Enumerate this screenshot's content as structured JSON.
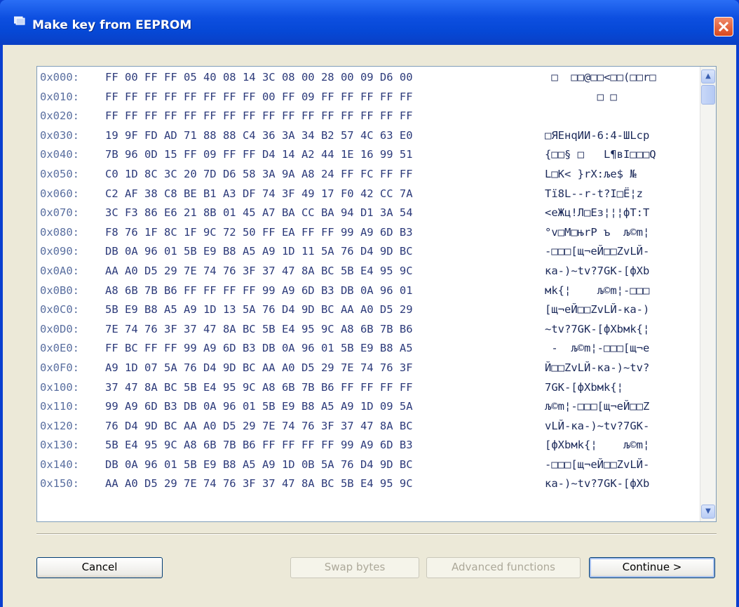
{
  "window": {
    "title": "Make key from EEPROM"
  },
  "hex_dump": {
    "rows": [
      {
        "addr": "0x000:",
        "bytes": "FF 00 FF FF 05 40 08 14 3C 08 00 28 00 09 D6 00",
        "ascii": " □  □□@□□<□□(□□r□"
      },
      {
        "addr": "0x010:",
        "bytes": "FF FF FF FF FF FF FF FF 00 FF 09 FF FF FF FF FF",
        "ascii": "        □ □"
      },
      {
        "addr": "0x020:",
        "bytes": "FF FF FF FF FF FF FF FF FF FF FF FF FF FF FF FF",
        "ascii": ""
      },
      {
        "addr": "0x030:",
        "bytes": "19 9F FD AD 71 88 88 C4 36 3A 34 B2 57 4C 63 E0",
        "ascii": "□ЯEнqИИ-6:4-ШLcp"
      },
      {
        "addr": "0x040:",
        "bytes": "7B 96 0D 15 FF 09 FF FF D4 14 A2 44 1E 16 99 51",
        "ascii": "{□□§ □   L¶вI□□□Q"
      },
      {
        "addr": "0x050:",
        "bytes": "C0 1D 8C 3C 20 7D D6 58 3A 9A A8 24 FF FC FF FF",
        "ascii": "L□К< }rX:ље$ №"
      },
      {
        "addr": "0x060:",
        "bytes": "C2 AF 38 C8 BE B1 A3 DF 74 3F 49 17 F0 42 CC 7A",
        "ascii": "Tї8L--r-t?I□Ё¦z"
      },
      {
        "addr": "0x070:",
        "bytes": "3C F3 86 E6 21 8B 01 45 A7 BA CC BA 94 D1 3A 54",
        "ascii": "<еЖц!Л□Eз¦¦¦фT:T"
      },
      {
        "addr": "0x080:",
        "bytes": "F8 76 1F 8C 1F 9C 72 50 FF EA FF FF 99 A9 6D B3",
        "ascii": "°v□М□њrP ъ  љ©m¦"
      },
      {
        "addr": "0x090:",
        "bytes": "DB 0A 96 01 5B E9 B8 A5 A9 1D 11 5A 76 D4 9D BC",
        "ascii": "-□□□[щ¬еЙ□□ZvLЙ-"
      },
      {
        "addr": "0x0A0:",
        "bytes": "AA A0 D5 29 7E 74 76 3F 37 47 8A BC 5B E4 95 9C",
        "ascii": "ка-)~tv?7GK-[фXb"
      },
      {
        "addr": "0x0B0:",
        "bytes": "A8 6B 7B B6 FF FF FF FF 99 A9 6D B3 DB 0A 96 01",
        "ascii": "мk{¦    љ©m¦-□□□"
      },
      {
        "addr": "0x0C0:",
        "bytes": "5B E9 B8 A5 A9 1D 13 5A 76 D4 9D BC AA A0 D5 29",
        "ascii": "[щ¬еЙ□□ZvLЙ-ка-)"
      },
      {
        "addr": "0x0D0:",
        "bytes": "7E 74 76 3F 37 47 8A BC 5B E4 95 9C A8 6B 7B B6",
        "ascii": "~tv?7GK-[фXbмk{¦"
      },
      {
        "addr": "0x0E0:",
        "bytes": "FF BC FF FF 99 A9 6D B3 DB 0A 96 01 5B E9 B8 A5",
        "ascii": " -  љ©m¦-□□□[щ¬е"
      },
      {
        "addr": "0x0F0:",
        "bytes": "A9 1D 07 5A 76 D4 9D BC AA A0 D5 29 7E 74 76 3F",
        "ascii": "Й□□ZvLЙ-ка-)~tv?"
      },
      {
        "addr": "0x100:",
        "bytes": "37 47 8A BC 5B E4 95 9C A8 6B 7B B6 FF FF FF FF",
        "ascii": "7GK-[фXbмk{¦"
      },
      {
        "addr": "0x110:",
        "bytes": "99 A9 6D B3 DB 0A 96 01 5B E9 B8 A5 A9 1D 09 5A",
        "ascii": "љ©m¦-□□□[щ¬еЙ□□Z"
      },
      {
        "addr": "0x120:",
        "bytes": "76 D4 9D BC AA A0 D5 29 7E 74 76 3F 37 47 8A BC",
        "ascii": "vLЙ-ка-)~tv?7GK-"
      },
      {
        "addr": "0x130:",
        "bytes": "5B E4 95 9C A8 6B 7B B6 FF FF FF FF 99 A9 6D B3",
        "ascii": "[фXbмk{¦    љ©m¦"
      },
      {
        "addr": "0x140:",
        "bytes": "DB 0A 96 01 5B E9 B8 A5 A9 1D 0B 5A 76 D4 9D BC",
        "ascii": "-□□□[щ¬еЙ□□ZvLЙ-"
      },
      {
        "addr": "0x150:",
        "bytes": "AA A0 D5 29 7E 74 76 3F 37 47 8A BC 5B E4 95 9C",
        "ascii": "ка-)~tv?7GK-[фXb"
      }
    ]
  },
  "buttons": {
    "cancel": "Cancel",
    "swap_bytes": "Swap bytes",
    "advanced_functions": "Advanced functions",
    "continue": "Continue >"
  }
}
